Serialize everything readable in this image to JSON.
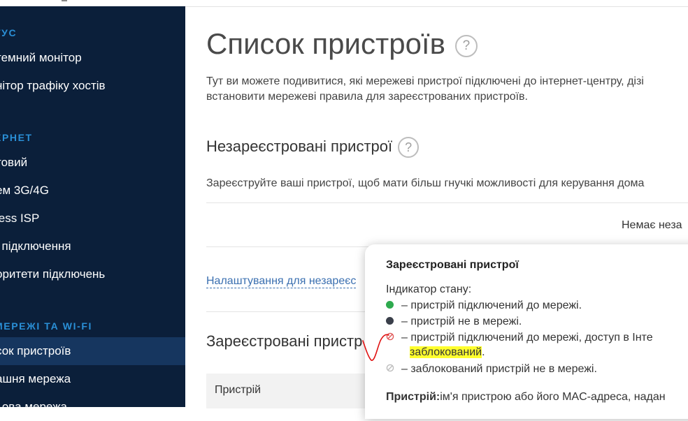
{
  "sidebar": {
    "sections": [
      {
        "label": "ТУС",
        "items": [
          {
            "label": "темний монітор",
            "active": false
          },
          {
            "label": "нітор трафіку хостів",
            "active": false
          }
        ]
      },
      {
        "label": "ЕРНЕТ",
        "items": [
          {
            "label": "товий",
            "active": false
          },
          {
            "label": "ем 3G/4G",
            "active": false
          },
          {
            "label": "less ISP",
            "active": false
          },
          {
            "label": "і підключення",
            "active": false
          },
          {
            "label": "оритети підключень",
            "active": false
          }
        ]
      },
      {
        "label": "МЕРЕЖІ ТА WI-FI",
        "items": [
          {
            "label": "сок пристроїв",
            "active": true
          },
          {
            "label": "ашня мережа",
            "active": false
          },
          {
            "label": "ьова мережа",
            "active": false
          }
        ]
      }
    ]
  },
  "main": {
    "title": "Список пристроїв",
    "help_symbol": "?",
    "description_lines": [
      "Тут ви можете подивитися, які мережеві пристрої підключені до інтернет-центру, дізі",
      "встановити мережеві правила для зареєстрованих пристроїв."
    ],
    "unregistered": {
      "heading": "Незареєстровані пристрої",
      "text": "Зареєструйте ваші пристрої, щоб мати більш гнучкі можливості для керування дома",
      "empty_text": "Немає неза",
      "settings_link": "Налаштування для незареєс"
    },
    "registered": {
      "heading": "Зареєстровані пристр",
      "column_device": "Пристрій"
    }
  },
  "tooltip": {
    "title": "Зареєстровані пристрої",
    "status_label": "Індикатор стану:",
    "lines": [
      {
        "icon": "green-dot-icon",
        "text": "– пристрій підключений до мережі."
      },
      {
        "icon": "dark-dot-icon",
        "text": "– пристрій не в мережі."
      },
      {
        "icon": "blocked-red-icon",
        "text": "– пристрій підключений до мережі, доступ в Інте"
      },
      {
        "icon": "none",
        "text": "заблокований",
        "suffix": "."
      },
      {
        "icon": "blocked-gray-icon",
        "text": "– заблокований пристрій не в мережі."
      }
    ],
    "device_bold": "Пристрій:",
    "device_text": "ім'я пристрою або його MAC-адреса, надан",
    "colors": {
      "green": "#2eaa4e",
      "dark": "#3a3f4a",
      "blocked_red": "#e05a5a",
      "blocked_gray": "#bdbdbd",
      "highlight": "#ffff2e",
      "pen": "#e01010"
    }
  }
}
